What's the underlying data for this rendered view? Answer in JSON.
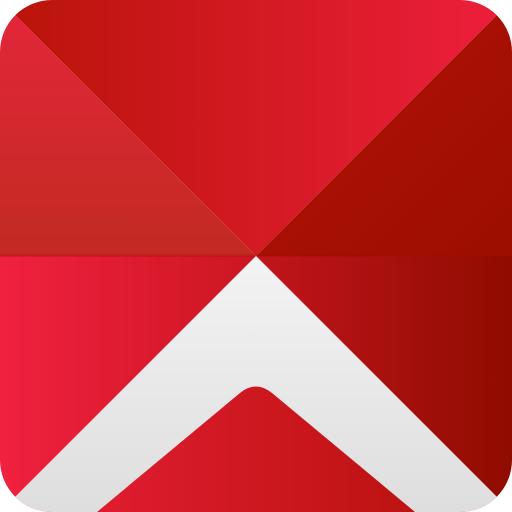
{
  "icon": {
    "name": "app-icon",
    "shape": "rounded-square",
    "glyph": "chevron-up-icon",
    "colors": {
      "red_light": "#f0213f",
      "red_mid": "#cf1820",
      "red_dark": "#a30f05",
      "red_deep": "#8f0c00",
      "chevron_light": "#f3f3f3",
      "chevron_shade": "#dedede"
    }
  }
}
